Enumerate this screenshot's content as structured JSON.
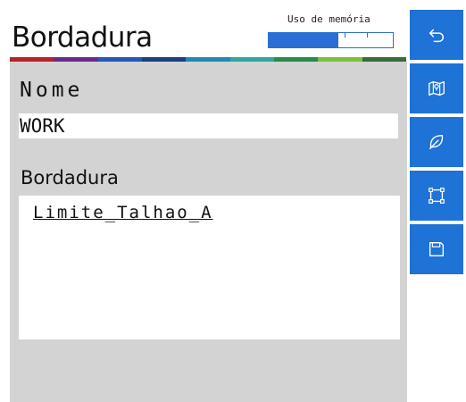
{
  "header": {
    "title": "Bordadura",
    "memory": {
      "label": "Uso de memória",
      "usage_fraction": 0.56,
      "fill_color": "#2a6ed6"
    }
  },
  "stripe_colors": [
    "#b8202a",
    "#6a2a8a",
    "#2457b8",
    "#1b3f7a",
    "#1f8ab3",
    "#2ea6a0",
    "#2a8a4a",
    "#7dbf3a",
    "#3a6a3a"
  ],
  "form": {
    "name_label": "Nome",
    "name_value": "WORK",
    "boundary_label": "Bordadura",
    "boundary_items": [
      "Limite_Talhao_A"
    ]
  },
  "sidebar": {
    "accent": "#1f72d6",
    "buttons": [
      {
        "name": "back",
        "icon": "back-arrow-icon"
      },
      {
        "name": "map",
        "icon": "map-icon"
      },
      {
        "name": "leaf",
        "icon": "leaf-icon"
      },
      {
        "name": "boundary-shape",
        "icon": "square-nodes-icon"
      },
      {
        "name": "save",
        "icon": "save-icon"
      }
    ]
  }
}
